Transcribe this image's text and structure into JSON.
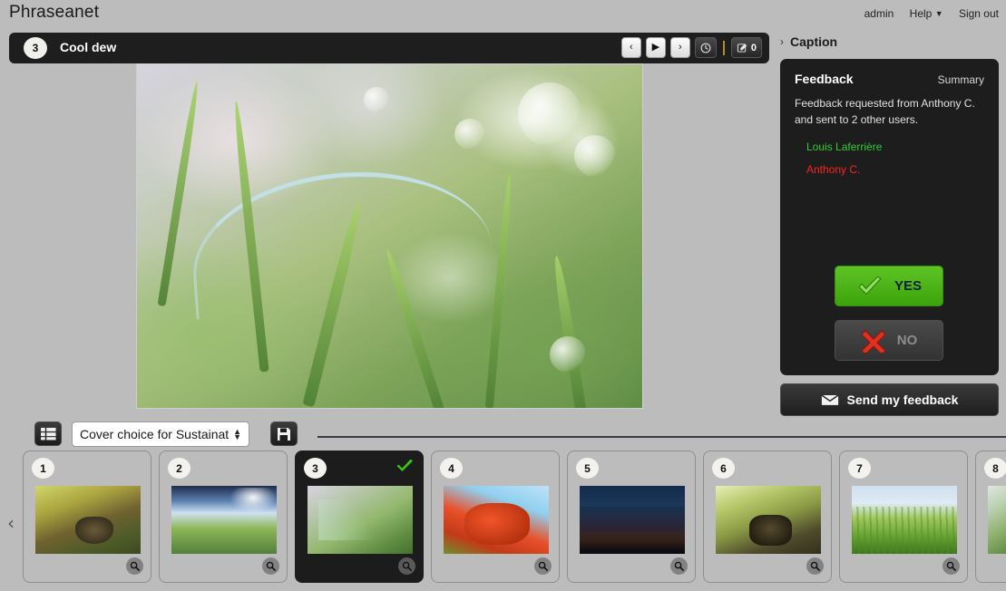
{
  "app": {
    "brand": "Phraseanet"
  },
  "account": {
    "user": "admin",
    "help": "Help",
    "help_caret": "▼",
    "sign_out": "Sign out"
  },
  "record": {
    "number": "3",
    "title": "Cool dew",
    "nav": {
      "prev": "‹",
      "play": "▶",
      "next": "›",
      "history_icon": "clock-icon",
      "edit_icon": "edit-icon",
      "edit_count": "0"
    }
  },
  "caption": {
    "chevron": "›",
    "label": "Caption"
  },
  "feedback": {
    "title": "Feedback",
    "summary_link": "Summary",
    "description_line1": "Feedback requested from Anthony C.",
    "description_line2": "and sent to 2 other users.",
    "users": [
      {
        "name": "Louis Laferrière",
        "color": "#33cc33"
      },
      {
        "name": "Anthony C.",
        "color": "#ff2222"
      }
    ],
    "yes_label": "YES",
    "no_label": "NO",
    "send_label": "Send my feedback"
  },
  "toolbar": {
    "list_icon": "list-view-icon",
    "cover_select_value": "Cover choice for Sustainat",
    "save_icon": "save-icon"
  },
  "strip": {
    "arrow_left": "‹",
    "arrow_right": "›",
    "check_glyph": "✔",
    "thumbnails": [
      {
        "number": "1",
        "selected": false,
        "photo_class": "p1"
      },
      {
        "number": "2",
        "selected": false,
        "photo_class": "p2"
      },
      {
        "number": "3",
        "selected": true,
        "photo_class": "p3"
      },
      {
        "number": "4",
        "selected": false,
        "photo_class": "p4"
      },
      {
        "number": "5",
        "selected": false,
        "photo_class": "p5"
      },
      {
        "number": "6",
        "selected": false,
        "photo_class": "p6"
      },
      {
        "number": "7",
        "selected": false,
        "photo_class": "p7"
      },
      {
        "number": "8",
        "selected": false,
        "photo_class": "p8"
      }
    ]
  },
  "colors": {
    "page_bg": "#bcbcbc",
    "dark_panel": "#1d1d1d",
    "accent_green": "#4db91a",
    "accent_red": "#d52a18"
  }
}
